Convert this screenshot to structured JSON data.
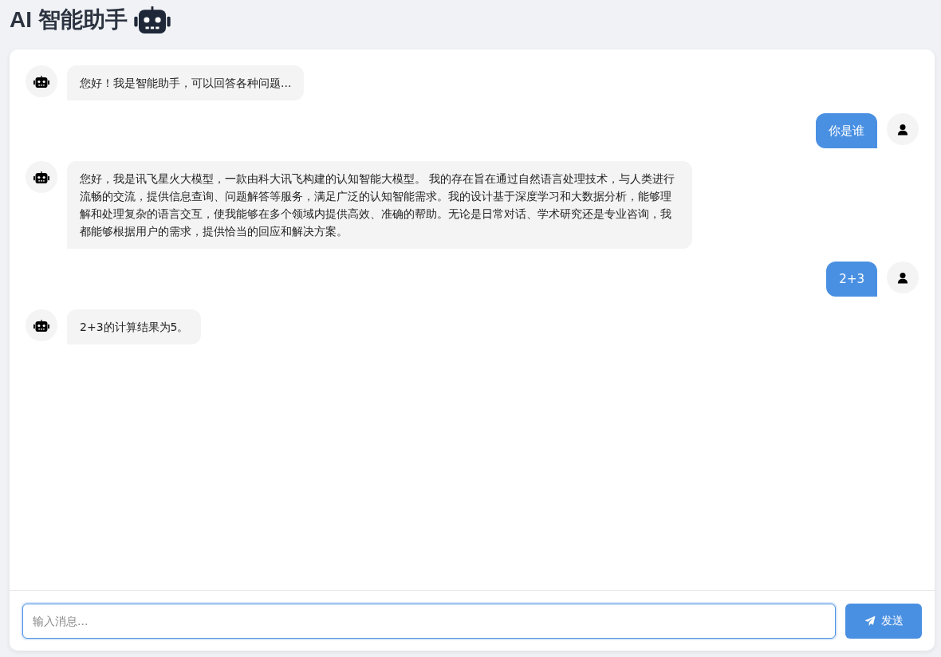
{
  "title": "AI 智能助手",
  "messages": [
    {
      "kind": "bot",
      "text": "您好！我是智能助手，可以回答各种问题..."
    },
    {
      "kind": "user",
      "text": "你是谁"
    },
    {
      "kind": "bot",
      "text": "您好，我是讯飞星火大模型，一款由科大讯飞构建的认知智能大模型。 我的存在旨在通过自然语言处理技术，与人类进行流畅的交流，提供信息查询、问题解答等服务，满足广泛的认知智能需求。我的设计基于深度学习和大数据分析，能够理解和处理复杂的语言交互，使我能够在多个领域内提供高效、准确的帮助。无论是日常对话、学术研究还是专业咨询，我都能够根据用户的需求，提供恰当的回应和解决方案。"
    },
    {
      "kind": "user",
      "text": "2+3"
    },
    {
      "kind": "bot",
      "text": "2+3的计算结果为5。"
    }
  ],
  "input": {
    "placeholder": "输入消息..."
  },
  "send_button": {
    "label": "发送"
  }
}
